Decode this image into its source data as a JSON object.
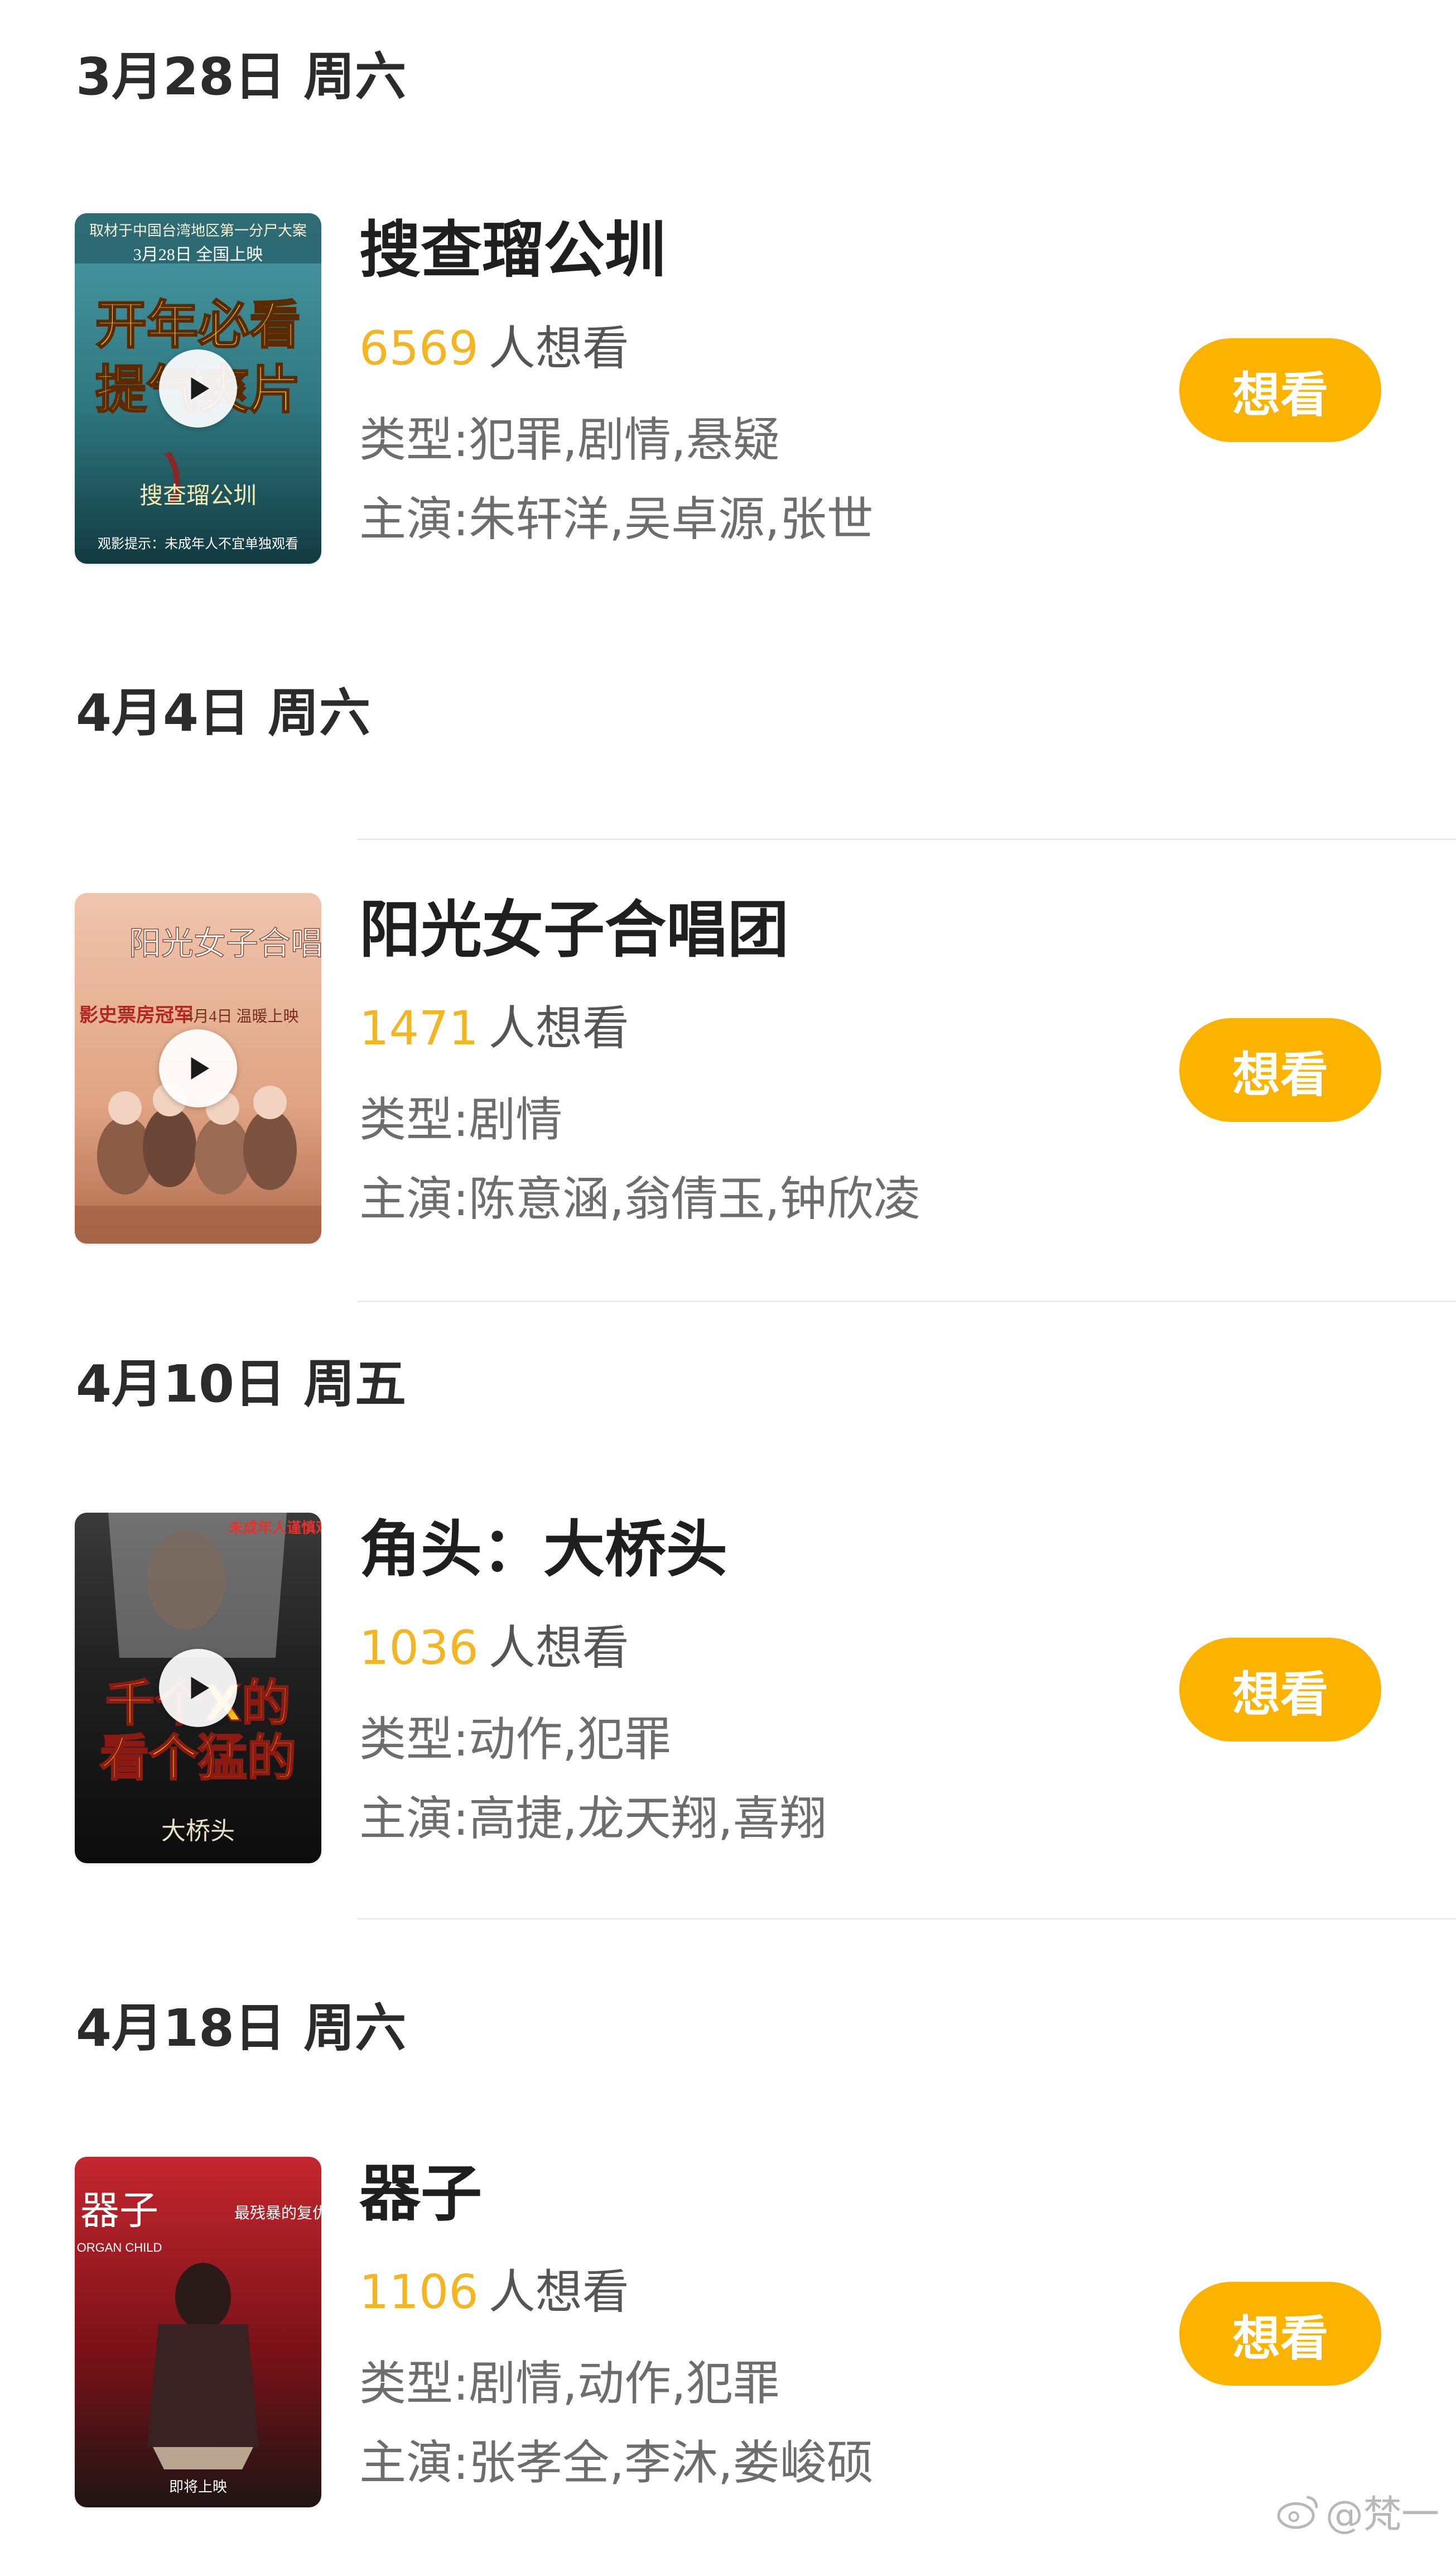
{
  "sections": [
    {
      "date": "3月28日 周六",
      "movie": {
        "title": "搜查瑠公圳",
        "want_count": "6569",
        "want_suffix": "人想看",
        "genre": "类型:犯罪,剧情,悬疑",
        "cast": "主演:朱轩洋,吴卓源,张世",
        "button": "想看",
        "poster_text_top": "取材于中国台湾地区第一分尸大案",
        "poster_text_date": "3月28日 全国上映",
        "poster_text_main1": "开年必看",
        "poster_text_main2": "提气爽片",
        "poster_text_logo": "搜查瑠公圳",
        "poster_text_bottom": "观影提示：未成年人不宜单独观看",
        "poster_colors": [
          "#3f8d9a",
          "#1b4e55",
          "#f2d21a"
        ]
      }
    },
    {
      "date": "4月4日 周六",
      "movie": {
        "title": "阳光女子合唱团",
        "want_count": "1471",
        "want_suffix": "人想看",
        "genre": "类型:剧情",
        "cast": "主演:陈意涵,翁倩玉,钟欣凌",
        "button": "想看",
        "poster_text_title": "阳光女子合唱团",
        "poster_text_badge": "影史票房冠军",
        "poster_text_date": "4月4日 温暖上映",
        "poster_colors": [
          "#e9b79f",
          "#c97d5d",
          "#7a3b2a"
        ]
      }
    },
    {
      "date": "4月10日 周五",
      "movie": {
        "title": "角头：大桥头",
        "want_count": "1036",
        "want_suffix": "人想看",
        "genre": "类型:动作,犯罪",
        "cast": "主演:高捷,龙天翔,喜翔",
        "button": "想看",
        "poster_text_warning": "未成年人谨慎观看",
        "poster_text_main1": "千个X的",
        "poster_text_main2": "看个猛的",
        "poster_text_logo": "大桥头",
        "poster_colors": [
          "#2a2a2a",
          "#e3332c",
          "#f0c419"
        ]
      }
    },
    {
      "date": "4月18日 周六",
      "movie": {
        "title": "器子",
        "want_count": "1106",
        "want_suffix": "人想看",
        "genre": "类型:剧情,动作,犯罪",
        "cast": "主演:张孝全,李沐,娄峻硕",
        "button": "想看",
        "poster_text_title": "器子",
        "poster_text_en": "ORGAN CHILD",
        "poster_text_tagline": "最残暴的复仇",
        "poster_text_release": "即将上映",
        "poster_colors": [
          "#b3222a",
          "#5c0f14",
          "#1e1414"
        ]
      }
    }
  ],
  "watermark": {
    "text": "@梵一"
  },
  "colors": {
    "accent": "#fbb300",
    "want_count": "#f4b522",
    "text_primary": "#1f1f1f",
    "text_secondary": "#6d6d6d"
  },
  "icons": {
    "play": "play-icon",
    "watermark_logo": "weibo-icon"
  }
}
